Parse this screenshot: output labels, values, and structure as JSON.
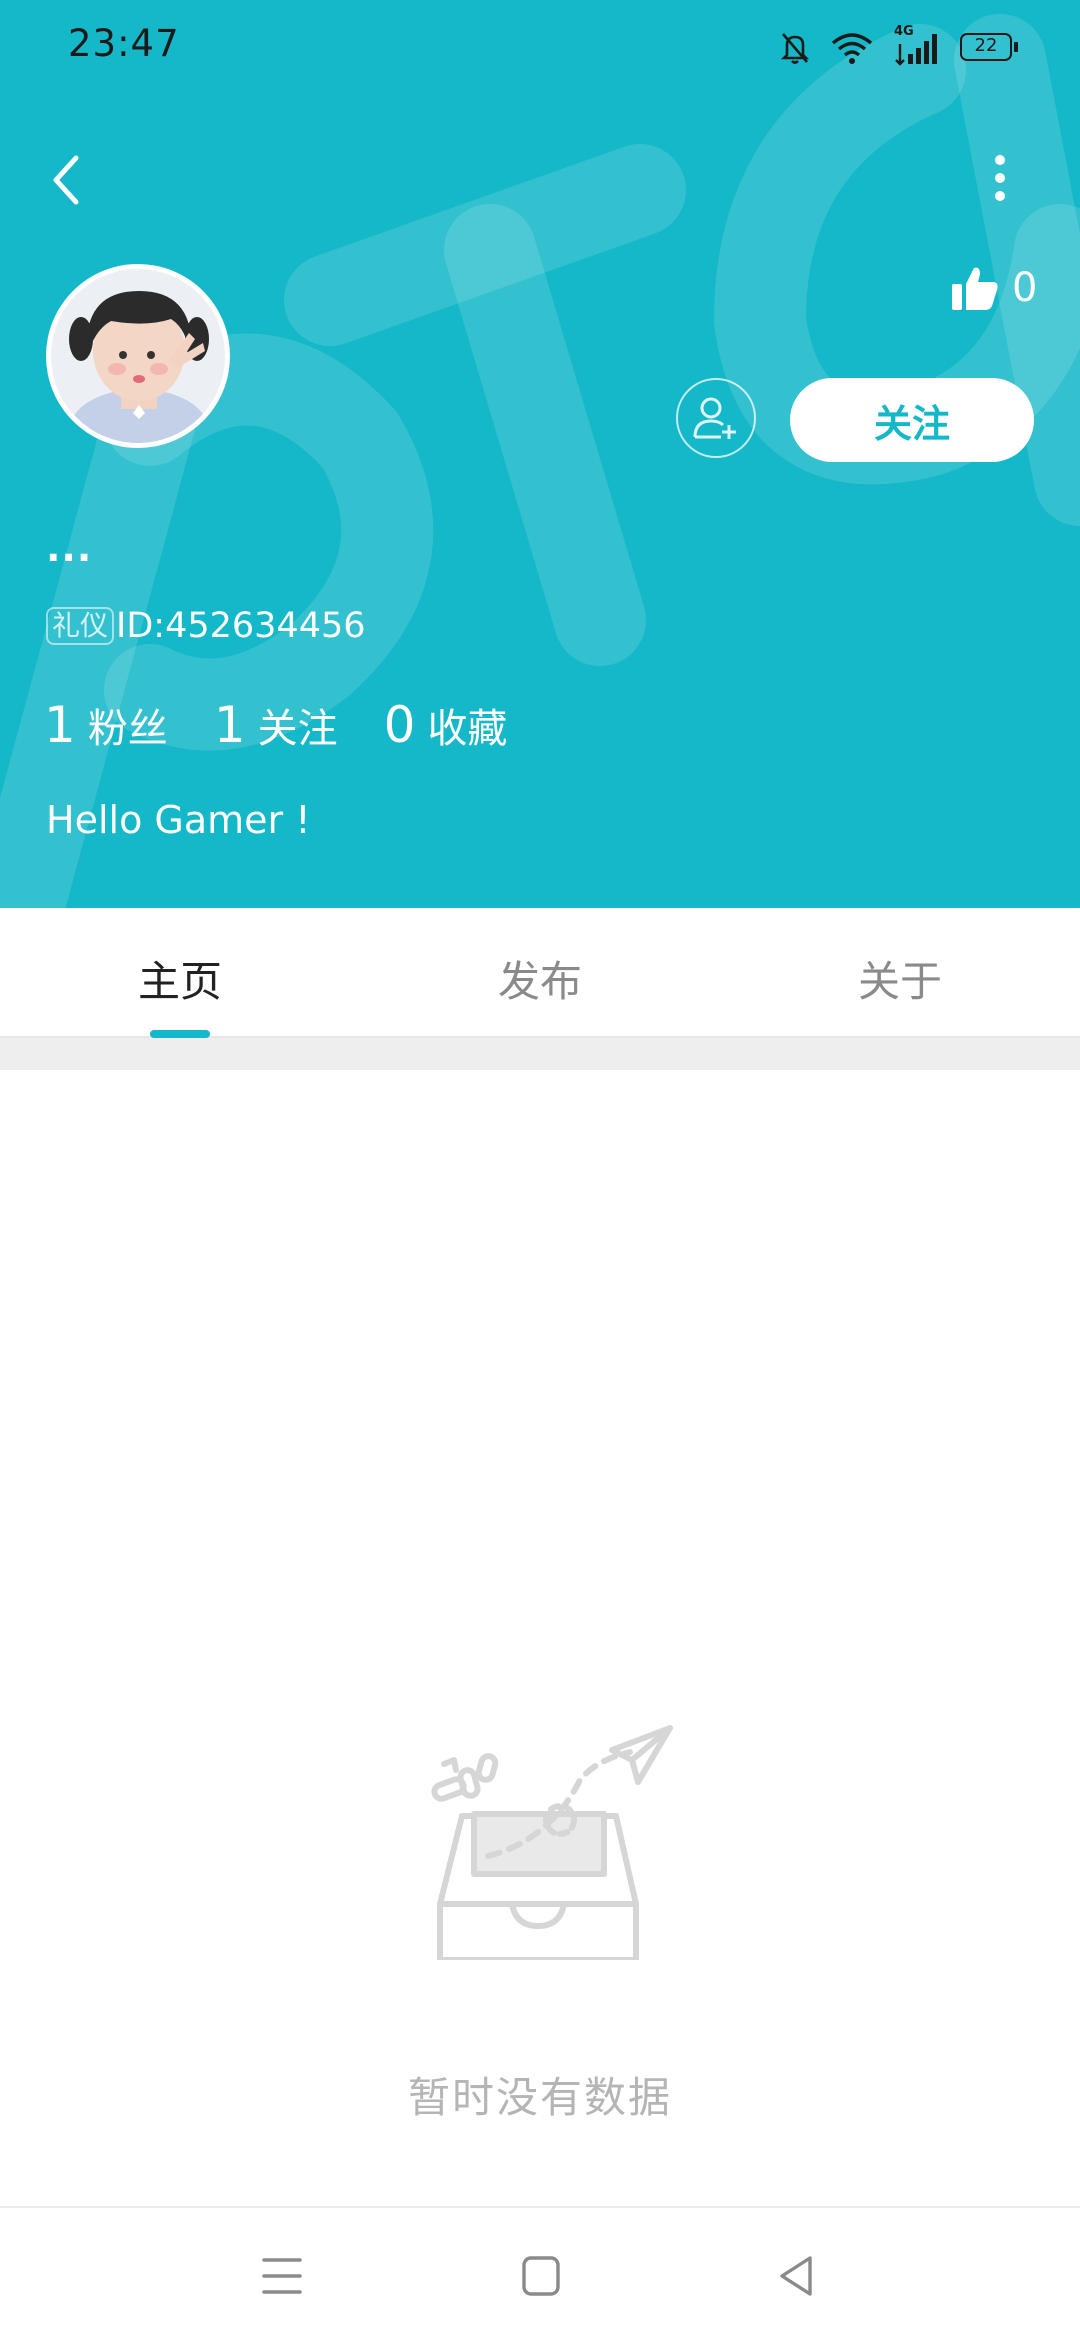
{
  "status_bar": {
    "time": "23:47",
    "network": "4G",
    "battery": "22",
    "icons": [
      "mute-bell-icon",
      "wifi-icon",
      "signal-icon",
      "battery-icon"
    ]
  },
  "header": {
    "back_icon": "chevron-left-icon",
    "more_icon": "more-vertical-icon",
    "likes_count": "0",
    "follow_label": "关注",
    "nickname": "...",
    "badge": "礼仪",
    "id_text": "ID:452634456",
    "stats": [
      {
        "value": "1",
        "label": "粉丝"
      },
      {
        "value": "1",
        "label": "关注"
      },
      {
        "value": "0",
        "label": "收藏"
      }
    ],
    "bio": "Hello Gamer !"
  },
  "tabs": [
    {
      "label": "主页",
      "active": true
    },
    {
      "label": "发布",
      "active": false
    },
    {
      "label": "关于",
      "active": false
    }
  ],
  "empty_state": {
    "text": "暂时没有数据",
    "icon": "empty-inbox-icon"
  },
  "nav_bar": {
    "icons": [
      "menu-icon",
      "home-icon",
      "back-triangle-icon"
    ]
  },
  "colors": {
    "accent": "#15b8c8",
    "header_bg": "#15b8c8",
    "empty_text": "#b5b5b5"
  }
}
